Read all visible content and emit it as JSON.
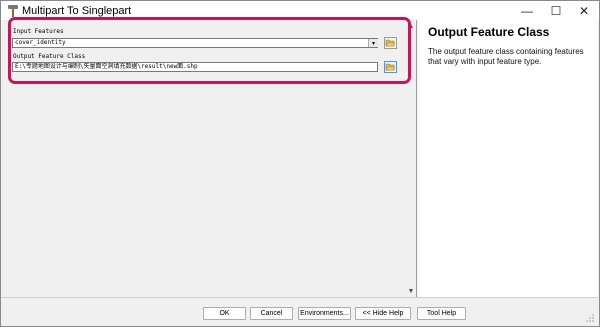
{
  "window": {
    "title": "Multipart To Singlepart",
    "app_icon": "hammer-icon",
    "controls": {
      "minimize": "—",
      "maximize": "☐",
      "close": "✕"
    }
  },
  "form": {
    "input_label": "Input Features",
    "input_value": "cover_identity",
    "output_label": "Output Feature Class",
    "output_value": "E:\\专题地图设计与编制\\矢量面空洞填充数据\\result\\new面.shp"
  },
  "help": {
    "title": "Output Feature Class",
    "text": "The output feature class containing features that vary with input feature type."
  },
  "buttons": {
    "ok": "OK",
    "cancel": "Cancel",
    "environments": "Environments...",
    "hide_help": "<< Hide Help",
    "tool_help": "Tool Help"
  },
  "colors": {
    "highlight": "#c0185c",
    "folder": "#e2b64a"
  }
}
